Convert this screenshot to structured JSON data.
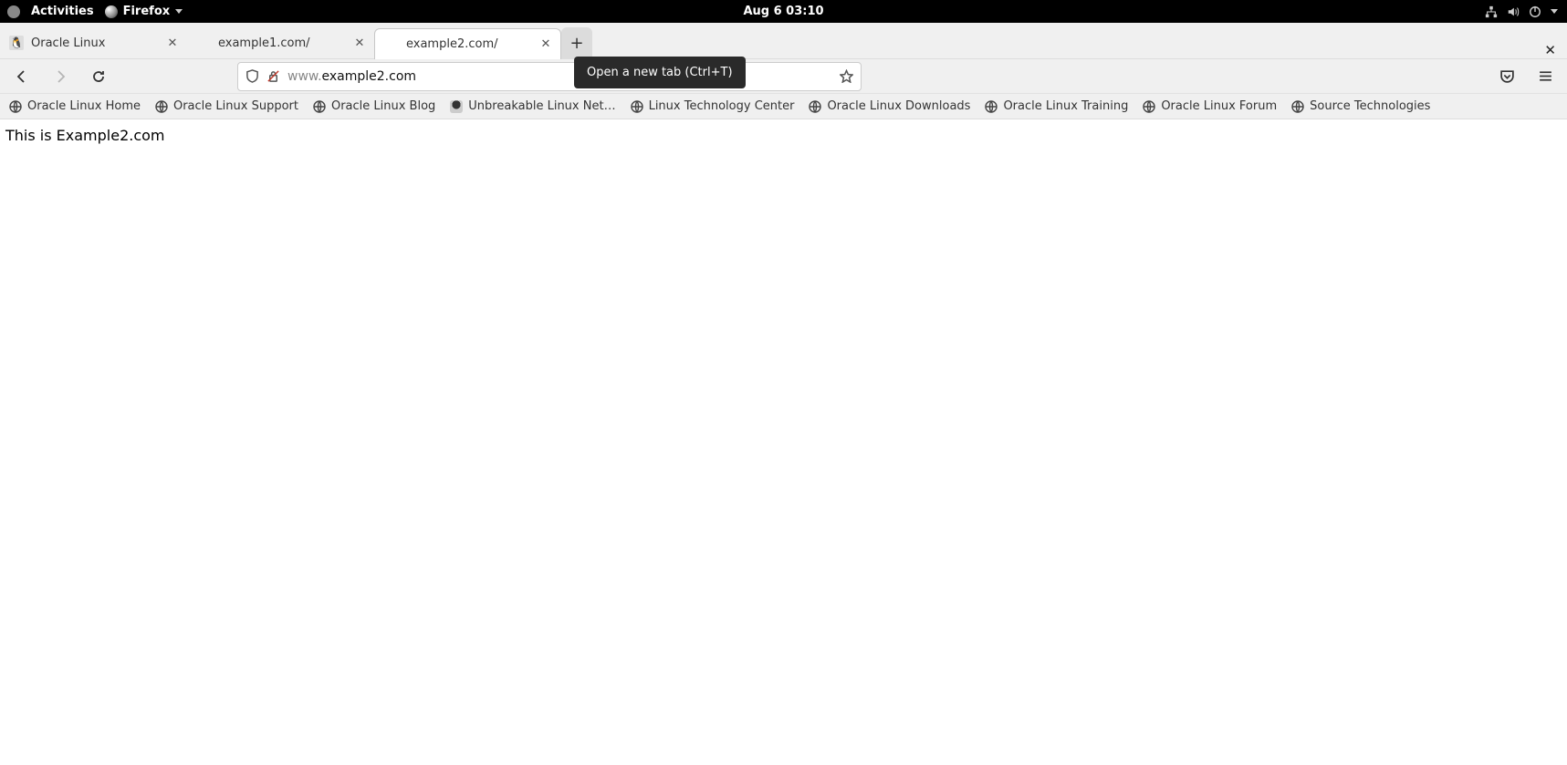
{
  "topbar": {
    "activities": "Activities",
    "app_name": "Firefox",
    "datetime": "Aug 6  03:10"
  },
  "tabs": [
    {
      "title": "Oracle Linux",
      "active": false
    },
    {
      "title": "example1.com/",
      "active": false
    },
    {
      "title": "example2.com/",
      "active": true
    }
  ],
  "tooltip": "Open a new tab (Ctrl+T)",
  "url": {
    "prefix": "www.",
    "host": "example2.com"
  },
  "bookmarks": [
    "Oracle Linux Home",
    "Oracle Linux Support",
    "Oracle Linux Blog",
    "Unbreakable Linux Net…",
    "Linux Technology Center",
    "Oracle Linux Downloads",
    "Oracle Linux Training",
    "Oracle Linux Forum",
    "Source Technologies"
  ],
  "page_body": "This is Example2.com"
}
